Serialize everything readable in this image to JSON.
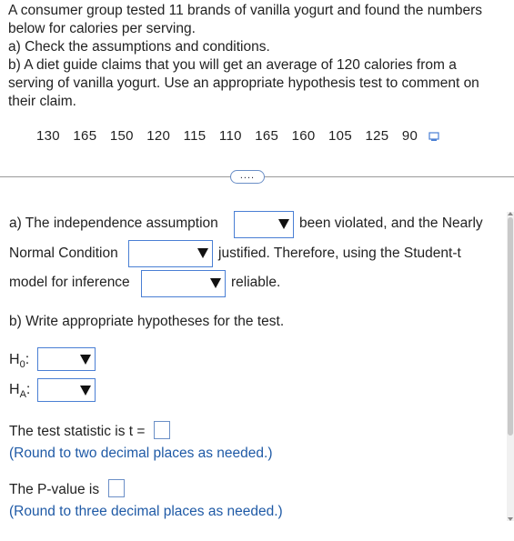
{
  "problem": {
    "line1": "A consumer group tested 11 brands of vanilla yogurt and found the numbers",
    "line2": "below for calories per serving.",
    "line3": "a) Check the assumptions and conditions.",
    "line4": "b) A diet guide claims that you will get an average of 120 calories from a",
    "line5": "serving of vanilla yogurt. Use an appropriate hypothesis test to comment on",
    "line6": "their claim.",
    "values": [
      "130",
      "165",
      "150",
      "120",
      "115",
      "110",
      "165",
      "160",
      "105",
      "125",
      "90"
    ]
  },
  "expand_label": "....",
  "part_a": {
    "text1": "a) The independence assumption",
    "text2": "been violated, and the Nearly",
    "text3": "Normal Condition",
    "text4": "justified. Therefore, using the Student-t",
    "text5": "model for inference",
    "text6": "reliable."
  },
  "part_b": {
    "prompt": "b) Write appropriate hypotheses for the test.",
    "h0_label": "H",
    "h0_sub": "0",
    "ha_label": "H",
    "ha_sub": "A",
    "colon": ":",
    "test_stat": "The test statistic is t =",
    "round_two": "(Round to two decimal places as needed.)",
    "pvalue": "The P-value is",
    "round_three": "(Round to three decimal places as needed.)"
  }
}
